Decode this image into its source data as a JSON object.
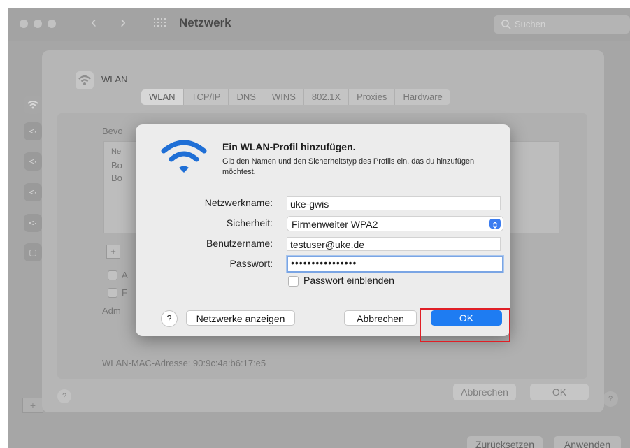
{
  "window": {
    "title": "Netzwerk",
    "search_placeholder": "Suchen",
    "nav_back": "‹",
    "nav_forward": "›"
  },
  "sheet": {
    "title": "WLAN",
    "tabs": [
      "WLAN",
      "TCP/IP",
      "DNS",
      "WINS",
      "802.1X",
      "Proxies",
      "Hardware"
    ],
    "preferred_label": "Bevo",
    "list_header": "Ne",
    "list_rows": [
      "Bo",
      "Bo"
    ],
    "list_plus": "+",
    "checkbox1_label": "A",
    "checkbox2_label": "F",
    "admin_label": "Adm",
    "mac_label": "WLAN-MAC-Adresse:",
    "mac_value": "90:9c:4a:b6:17:e5",
    "help": "?",
    "cancel_label": "Abbrechen",
    "ok_label": "OK"
  },
  "background": {
    "plus": "+",
    "help": "?",
    "reset_label": "Zurücksetzen",
    "apply_label": "Anwenden",
    "side_icons": [
      "wifi-icon",
      "ethernet-icon",
      "ethernet-icon",
      "ethernet-icon",
      "ethernet-icon",
      "lock-icon"
    ]
  },
  "dialog": {
    "title": "Ein WLAN-Profil hinzufügen.",
    "description": "Gib den Namen und den Sicherheitstyp des Profils ein, das du hinzufügen möchtest.",
    "network_name_label": "Netzwerkname:",
    "network_name_value": "uke-gwis",
    "security_label": "Sicherheit:",
    "security_value": "Firmenweiter WPA2",
    "username_label": "Benutzername:",
    "username_value": "testuser@uke.de",
    "password_label": "Passwort:",
    "password_value": "••••••••••••••••",
    "show_password_label": "Passwort einblenden",
    "show_password_checked": false,
    "help": "?",
    "show_networks_label": "Netzwerke anzeigen",
    "cancel_label": "Abbrechen",
    "ok_label": "OK"
  },
  "colors": {
    "accent": "#1e7cf2",
    "wifi_icon": "#1f6fd6",
    "highlight_box": "#e01f26"
  }
}
